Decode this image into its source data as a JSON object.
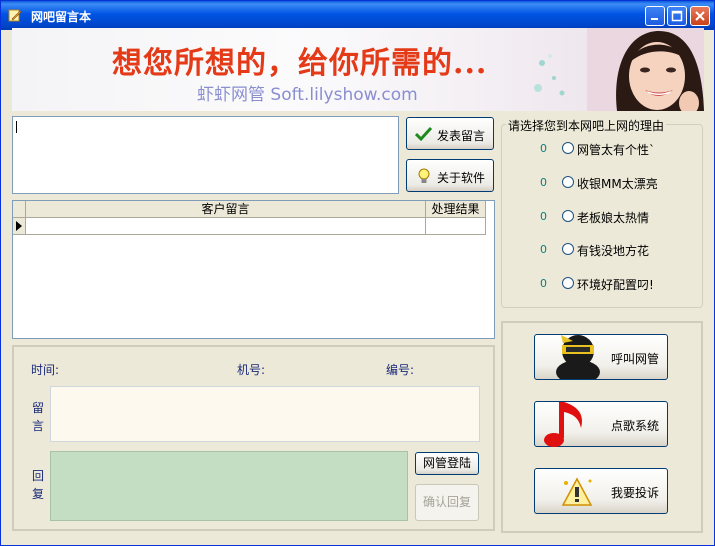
{
  "window": {
    "title": "网吧留言本",
    "controls": [
      "minimize",
      "maximize",
      "close"
    ]
  },
  "banner": {
    "slogan": "想您所想的，给你所需的...",
    "brand": "虾虾网管 Soft.lilyshow.com"
  },
  "buttons": {
    "post": "发表留言",
    "about": "关于软件",
    "admin_login": "网管登陆",
    "confirm_reply": "确认回复"
  },
  "grid": {
    "columns": [
      "客户留言",
      "处理结果"
    ],
    "rows": [
      {
        "message": "",
        "result": ""
      }
    ]
  },
  "details": {
    "time_label": "时间:",
    "machine_label": "机号:",
    "number_label": "编号:",
    "message_label": "留\n言",
    "reply_label": "回\n复"
  },
  "reasons": {
    "title": "请选择您到本网吧上网的理由",
    "items": [
      {
        "count": "0",
        "label": "网管太有个性`"
      },
      {
        "count": "0",
        "label": "收银MM太漂亮"
      },
      {
        "count": "0",
        "label": "老板娘太热情"
      },
      {
        "count": "0",
        "label": "有钱没地方花"
      },
      {
        "count": "0",
        "label": "环境好配置叼!"
      }
    ]
  },
  "actions": [
    {
      "label": "呼叫网管",
      "icon": "ninja-icon"
    },
    {
      "label": "点歌系统",
      "icon": "music-note-icon"
    },
    {
      "label": "我要投诉",
      "icon": "complaint-icon"
    }
  ],
  "colors": {
    "title_bar": "#0054e3",
    "slogan": "#e43a18",
    "message_box": "#fdf9ee",
    "reply_box": "#c4dec4",
    "count": "#0b7e7e"
  }
}
